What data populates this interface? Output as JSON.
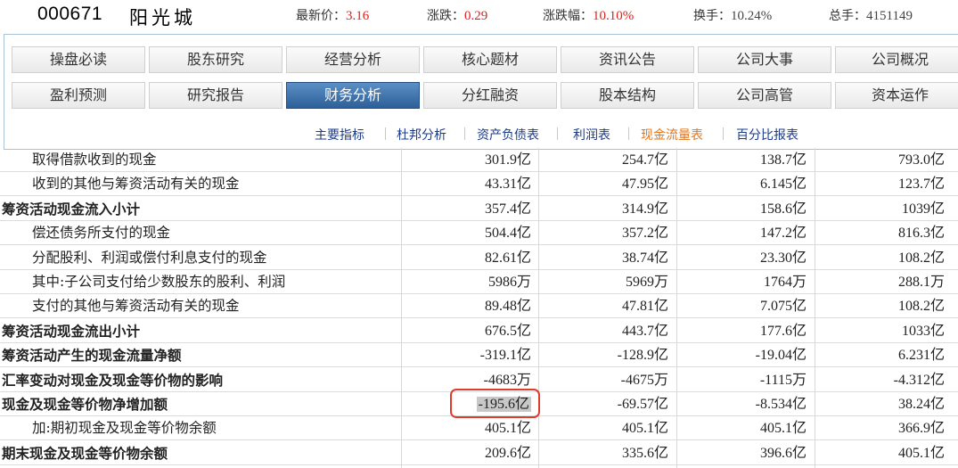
{
  "header": {
    "code": "000671",
    "name": "阳光城",
    "latest_price_label": "最新价：",
    "latest_price": "3.16",
    "change_label": "涨跌：",
    "change": "0.29",
    "change_pct_label": "涨跌幅：",
    "change_pct": "10.10%",
    "turnover_label": "换手：",
    "turnover": "10.24%",
    "total_volume_label": "总手：",
    "total_volume": "4151149"
  },
  "tabs_row1": [
    "操盘必读",
    "股东研究",
    "经营分析",
    "核心题材",
    "资讯公告",
    "公司大事",
    "公司概况"
  ],
  "tabs_row2": [
    "盈利预测",
    "研究报告",
    "财务分析",
    "分红融资",
    "股本结构",
    "公司高管",
    "资本运作"
  ],
  "active_tab": "财务分析",
  "subnav": [
    "主要指标",
    "杜邦分析",
    "资产负债表",
    "利润表",
    "现金流量表",
    "百分比报表"
  ],
  "active_subnav": "现金流量表",
  "rows": [
    {
      "label": "取得借款收到的现金",
      "indent": true,
      "bold": false,
      "values": [
        "301.9亿",
        "254.7亿",
        "138.7亿",
        "793.0亿"
      ]
    },
    {
      "label": "收到的其他与筹资活动有关的现金",
      "indent": true,
      "bold": false,
      "values": [
        "43.31亿",
        "47.95亿",
        "6.145亿",
        "123.7亿"
      ]
    },
    {
      "label": "筹资活动现金流入小计",
      "indent": false,
      "bold": true,
      "values": [
        "357.4亿",
        "314.9亿",
        "158.6亿",
        "1039亿"
      ]
    },
    {
      "label": "偿还债务所支付的现金",
      "indent": true,
      "bold": false,
      "values": [
        "504.4亿",
        "357.2亿",
        "147.2亿",
        "816.3亿"
      ]
    },
    {
      "label": "分配股利、利润或偿付利息支付的现金",
      "indent": true,
      "bold": false,
      "values": [
        "82.61亿",
        "38.74亿",
        "23.30亿",
        "108.2亿"
      ]
    },
    {
      "label": "其中:子公司支付给少数股东的股利、利润",
      "indent": true,
      "bold": false,
      "values": [
        "5986万",
        "5969万",
        "1764万",
        "288.1万"
      ]
    },
    {
      "label": "支付的其他与筹资活动有关的现金",
      "indent": true,
      "bold": false,
      "values": [
        "89.48亿",
        "47.81亿",
        "7.075亿",
        "108.2亿"
      ]
    },
    {
      "label": "筹资活动现金流出小计",
      "indent": false,
      "bold": true,
      "values": [
        "676.5亿",
        "443.7亿",
        "177.6亿",
        "1033亿"
      ]
    },
    {
      "label": "筹资活动产生的现金流量净额",
      "indent": false,
      "bold": true,
      "values": [
        "-319.1亿",
        "-128.9亿",
        "-19.04亿",
        "6.231亿"
      ]
    },
    {
      "label": "汇率变动对现金及现金等价物的影响",
      "indent": false,
      "bold": true,
      "values": [
        "-4683万",
        "-4675万",
        "-1115万",
        "-4.312亿"
      ]
    },
    {
      "label": "现金及现金等价物净增加额",
      "indent": false,
      "bold": true,
      "values": [
        "-195.6亿",
        "-69.57亿",
        "-8.534亿",
        "38.24亿"
      ]
    },
    {
      "label": "加:期初现金及现金等价物余额",
      "indent": true,
      "bold": false,
      "values": [
        "405.1亿",
        "405.1亿",
        "405.1亿",
        "366.9亿"
      ]
    },
    {
      "label": "期末现金及现金等价物余额",
      "indent": false,
      "bold": true,
      "values": [
        "209.6亿",
        "335.6亿",
        "396.6亿",
        "405.1亿"
      ]
    }
  ],
  "highlighted_value": "-195.6亿",
  "colors": {
    "accent_red": "#e0201c",
    "active_tab": "#2d5f98",
    "link": "#1a3b8c",
    "active_link": "#e2761f",
    "highlight_border": "#e23a2b"
  }
}
